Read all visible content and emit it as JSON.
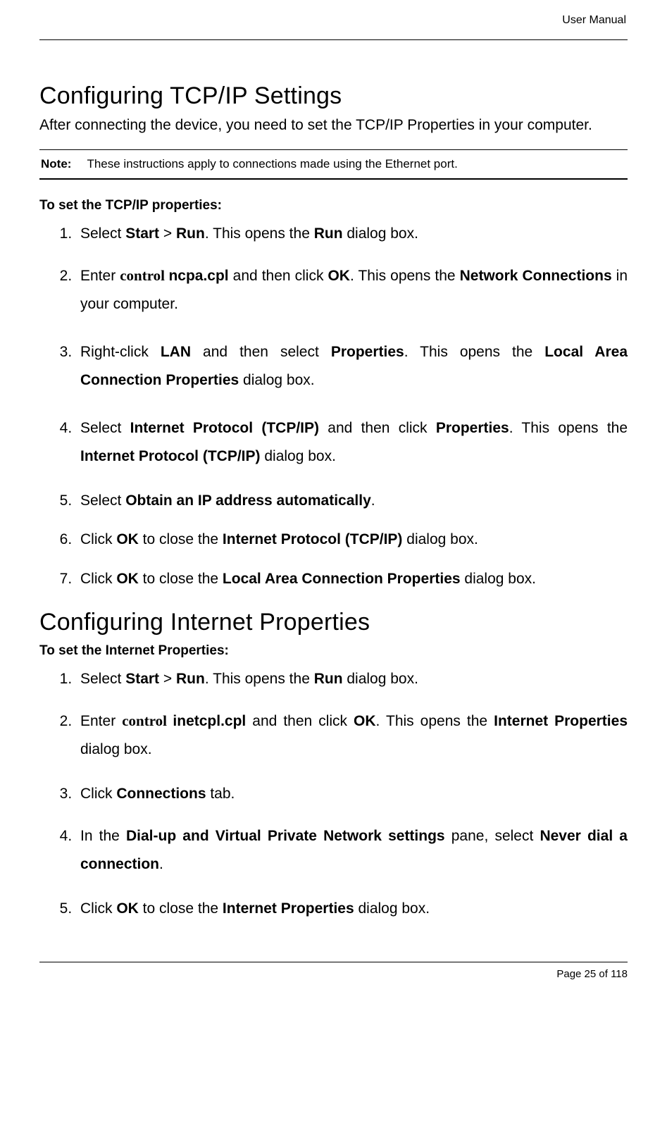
{
  "header": {
    "label": "User Manual"
  },
  "section1": {
    "title": "Configuring TCP/IP Settings",
    "lead": "After connecting the device, you need to set the TCP/IP Properties in your computer.",
    "note_label": "Note:",
    "note_text": "These instructions apply to connections made using the Ethernet port.",
    "subhead": "To set the TCP/IP properties:",
    "steps": {
      "s1_a": "Select ",
      "s1_b1": "Start",
      "s1_b2": " > ",
      "s1_b3": "Run",
      "s1_c": ". This opens the ",
      "s1_d": "Run",
      "s1_e": " dialog box.",
      "s2_a": "Enter ",
      "s2_cmd": "control ",
      "s2_cpl": "ncpa.cpl",
      "s2_b": " and then click ",
      "s2_ok": "OK",
      "s2_c": ". This opens the ",
      "s2_d": "Network Connections",
      "s2_e": " in your computer.",
      "s3_a": "Right-click ",
      "s3_b": "LAN",
      "s3_c": " and then select ",
      "s3_d": "Properties",
      "s3_e": ". This opens the ",
      "s3_f": "Local Area Connection Properties",
      "s3_g": " dialog box.",
      "s4_a": "Select ",
      "s4_b": "Internet Protocol (TCP/IP)",
      "s4_c": " and then click ",
      "s4_d": "Properties",
      "s4_e": ". This opens the ",
      "s4_f": "Internet Protocol (TCP/IP)",
      "s4_g": " dialog box.",
      "s5_a": "Select ",
      "s5_b": "Obtain an IP address automatically",
      "s5_c": ".",
      "s6_a": "Click ",
      "s6_b": "OK",
      "s6_c": " to close the ",
      "s6_d": "Internet Protocol (TCP/IP)",
      "s6_e": " dialog box.",
      "s7_a": "Click ",
      "s7_b": "OK",
      "s7_c": " to close the ",
      "s7_d": "Local Area Connection Properties",
      "s7_e": " dialog box."
    }
  },
  "section2": {
    "title": "Configuring Internet Properties",
    "subhead": "To set the Internet Properties:",
    "steps": {
      "s1_a": "Select ",
      "s1_b1": "Start",
      "s1_b2": " > ",
      "s1_b3": "Run",
      "s1_c": ". This opens the ",
      "s1_d": "Run",
      "s1_e": " dialog box.",
      "s2_a": "Enter ",
      "s2_cmd": "control ",
      "s2_cpl": "inetcpl.cpl",
      "s2_b": " and then click ",
      "s2_ok": "OK",
      "s2_c": ". This opens the ",
      "s2_d": "Internet Properties",
      "s2_e": " dialog box.",
      "s3_a": "Click ",
      "s3_b": "Connections",
      "s3_c": " tab.",
      "s4_a": "In the ",
      "s4_b": "Dial-up and Virtual Private Network settings",
      "s4_c": " pane, select ",
      "s4_d": "Never dial a connection",
      "s4_e": ".",
      "s5_a": "Click ",
      "s5_b": "OK",
      "s5_c": " to close the ",
      "s5_d": "Internet Properties",
      "s5_e": " dialog box."
    }
  },
  "footer": {
    "label": "Page 25 of 118"
  }
}
